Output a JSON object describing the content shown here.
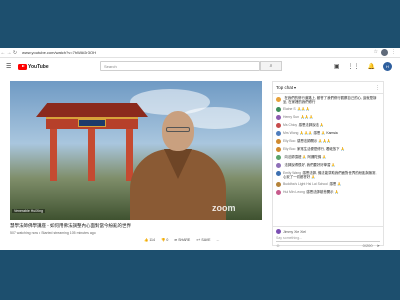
{
  "browser": {
    "url": "www.youtube.com/watch?v=7hWAfJr3OH",
    "avatar_initial": "H"
  },
  "header": {
    "brand": "YouTube",
    "search_placeholder": "Search"
  },
  "video": {
    "title": "慧學法師佛學講座 - 如何用佛法調整內心面對當今紛亂的世界",
    "meta": "507 watching now • Started streaming 105 minutes ago",
    "watermark": "zoom",
    "name_tag": "Venerable HuiXing",
    "actions": [
      {
        "icon": "thumbs-up-icon",
        "label": "114"
      },
      {
        "icon": "thumbs-down-icon",
        "label": "0"
      },
      {
        "icon": "share-icon",
        "label": "SHARE"
      },
      {
        "icon": "save-icon",
        "label": "SAVE"
      },
      {
        "icon": "more-icon",
        "label": "..."
      }
    ]
  },
  "chat": {
    "header": "Top chat",
    "messages": [
      {
        "author": "",
        "text": "在我們的修行道路上, 都會了我們修行觀察自己的心, 這就是靜坐, 在家裡的我們修行",
        "color": "#e7a13a"
      },
      {
        "author": "Elaine S",
        "text": "🙏🙏🙏",
        "color": "#3c8d5a"
      },
      {
        "author": "Henry Sun",
        "text": "🙏🙏🙏",
        "color": "#8c5bb0"
      },
      {
        "author": "Ms Chioy",
        "text": "感恩法師說法 🙏",
        "color": "#c74b4b"
      },
      {
        "author": "Mrs Wong",
        "text": "🙏🙏🙏 感恩 🙏 Kamsia",
        "color": "#4f7dbd"
      },
      {
        "author": "Elly Boo",
        "text": "感恩法師開示 🙏🙏🙏",
        "color": "#d08a2f"
      },
      {
        "author": "Elly Boo",
        "text": "家常生活便是修行, 看破放下 🙏",
        "color": "#d08a2f"
      },
      {
        "author": "",
        "text": "向法師頂禮 🙏 阿彌陀佛 🙏",
        "color": "#5aa36b"
      },
      {
        "author": "",
        "text": "法師說得很好, 我們要好好學習 🙏",
        "color": "#8e6fb8"
      },
      {
        "author": "Emily Wang",
        "text": "感恩法師, 佛法能幫助我們面對世界的紛亂與無常, 心安了一切都會好 🙏",
        "color": "#3d6fb0"
      },
      {
        "author": "Buddha's Light Hsi Lai School",
        "text": "感恩 🙏",
        "color": "#b5833a"
      },
      {
        "author": "Hui Min Leong",
        "text": "感恩法師慈悲開示 🙏",
        "color": "#c75a8c"
      }
    ],
    "input_user": "Jimmy Xie Xiel",
    "input_placeholder": "Say something...",
    "char_count": "0/200"
  }
}
